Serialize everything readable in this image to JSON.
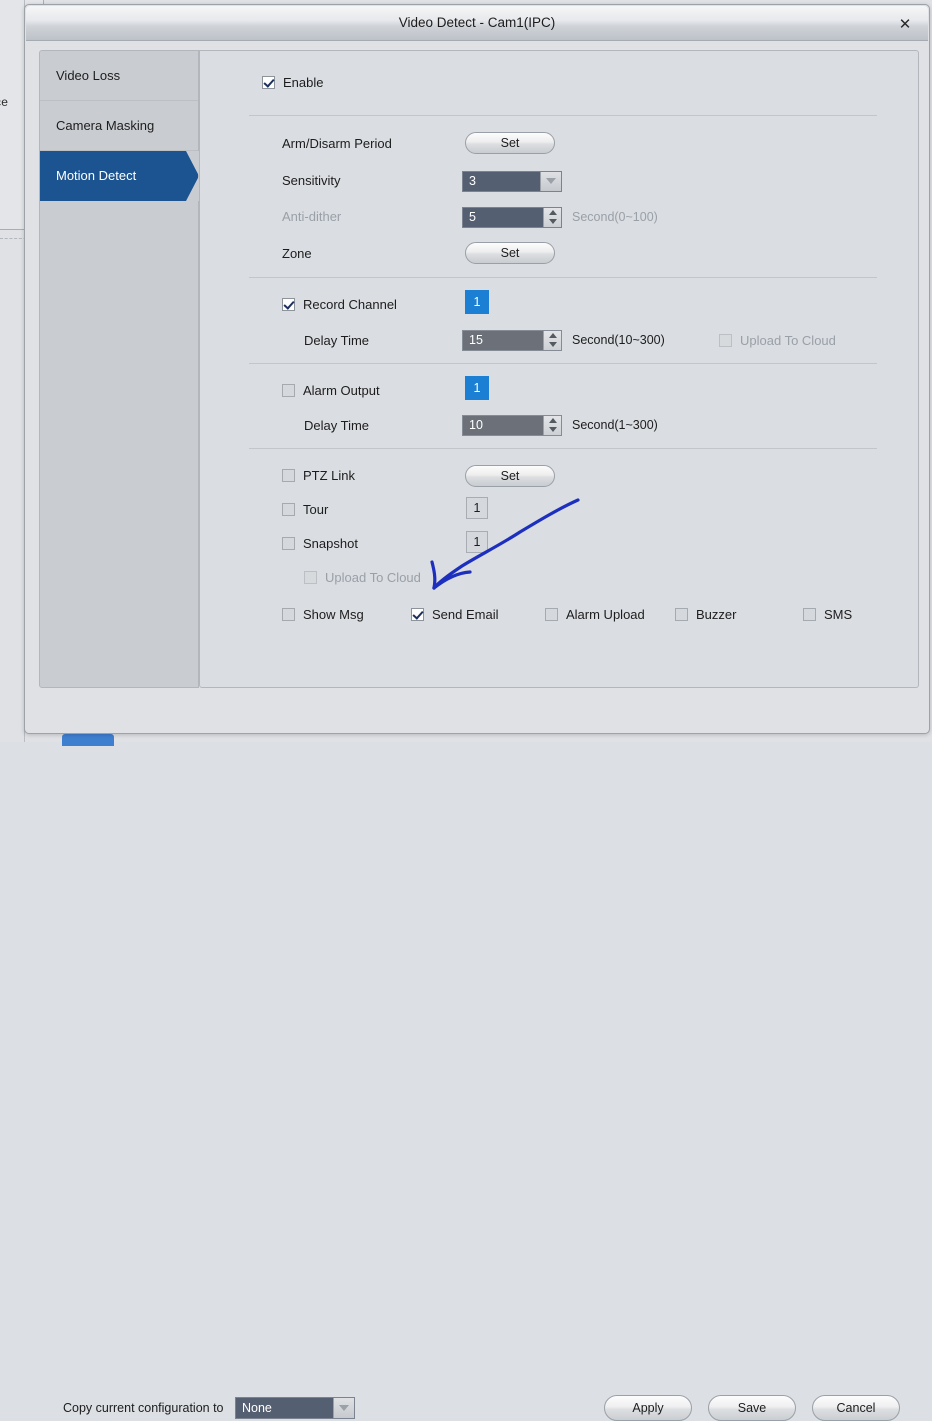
{
  "background": {
    "partial_text": "ce"
  },
  "window": {
    "title": "Video Detect - Cam1(IPC)",
    "close_label": "✕"
  },
  "sidebar": {
    "items": [
      {
        "label": "Video Loss",
        "active": false
      },
      {
        "label": "Camera Masking",
        "active": false
      },
      {
        "label": "Motion Detect",
        "active": true
      }
    ]
  },
  "main": {
    "enable": {
      "label": "Enable",
      "checked": true
    },
    "arm_disarm": {
      "label": "Arm/Disarm Period",
      "button": "Set"
    },
    "sensitivity": {
      "label": "Sensitivity",
      "value": "3"
    },
    "anti_dither": {
      "label": "Anti-dither",
      "value": "5",
      "unit": "Second(0~100)",
      "disabled": true
    },
    "zone": {
      "label": "Zone",
      "button": "Set"
    },
    "record_channel": {
      "label": "Record Channel",
      "checked": true,
      "channel": "1",
      "delay_label": "Delay Time",
      "delay_value": "15",
      "delay_unit": "Second(10~300)",
      "upload_label": "Upload To Cloud",
      "upload_checked": false,
      "upload_disabled": true
    },
    "alarm_output": {
      "label": "Alarm Output",
      "checked": false,
      "channel": "1",
      "delay_label": "Delay Time",
      "delay_value": "10",
      "delay_unit": "Second(1~300)"
    },
    "ptz_link": {
      "label": "PTZ Link",
      "checked": false,
      "button": "Set"
    },
    "tour": {
      "label": "Tour",
      "checked": false,
      "value": "1"
    },
    "snapshot": {
      "label": "Snapshot",
      "checked": false,
      "value": "1"
    },
    "upload_to_cloud": {
      "label": "Upload To Cloud",
      "checked": false,
      "disabled": true
    },
    "alarm_actions": [
      {
        "label": "Show Msg",
        "checked": false
      },
      {
        "label": "Send Email",
        "checked": true
      },
      {
        "label": "Alarm Upload",
        "checked": false
      },
      {
        "label": "Buzzer",
        "checked": false
      },
      {
        "label": "SMS",
        "checked": false
      }
    ]
  },
  "footer": {
    "copy_label": "Copy current configuration to",
    "copy_value": "None",
    "buttons": [
      "Apply",
      "Save",
      "Cancel"
    ]
  },
  "annotation": {
    "type": "hand-drawn-arrow",
    "color": "#1c2fbe",
    "points_to": "Send Email"
  },
  "colors": {
    "accent_blue": "#1b7fd4",
    "sidebar_active": "#1b5490",
    "field_slate": "#555f72",
    "dialog_bg": "#dfe1e5"
  }
}
